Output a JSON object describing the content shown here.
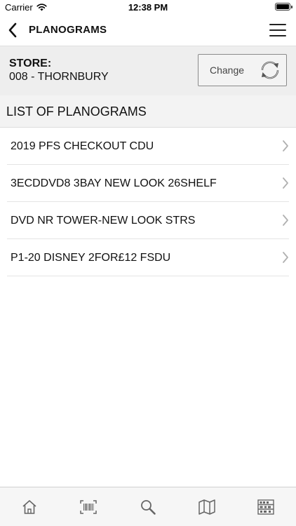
{
  "status_bar": {
    "carrier": "Carrier",
    "time": "12:38 PM",
    "wifi_icon": "wifi-icon",
    "battery_icon": "battery-icon"
  },
  "nav": {
    "title": "PLANOGRAMS",
    "back_icon": "chevron-left-icon",
    "menu_icon": "hamburger-menu-icon"
  },
  "store": {
    "label": "STORE:",
    "value": "008 - THORNBURY",
    "change_label": "Change",
    "change_icon": "refresh-icon"
  },
  "list": {
    "header": "LIST OF PLANOGRAMS",
    "items": [
      {
        "label": "2019 PFS CHECKOUT CDU"
      },
      {
        "label": "3ECDDVD8 3BAY NEW LOOK 26SHELF"
      },
      {
        "label": "DVD NR TOWER-NEW LOOK STRS"
      },
      {
        "label": "P1-20 DISNEY 2FOR£12 FSDU"
      }
    ],
    "chevron_icon": "chevron-right-icon"
  },
  "tab_bar": {
    "items": [
      {
        "icon": "home-icon"
      },
      {
        "icon": "barcode-scan-icon"
      },
      {
        "icon": "search-icon"
      },
      {
        "icon": "map-icon"
      },
      {
        "icon": "shelf-icon"
      }
    ]
  },
  "colors": {
    "panel_gray": "#eeeeee",
    "header_gray": "#f3f3f3",
    "text": "#111111",
    "icon_gray": "#666666",
    "chevron_gray": "#b0b0b0"
  }
}
